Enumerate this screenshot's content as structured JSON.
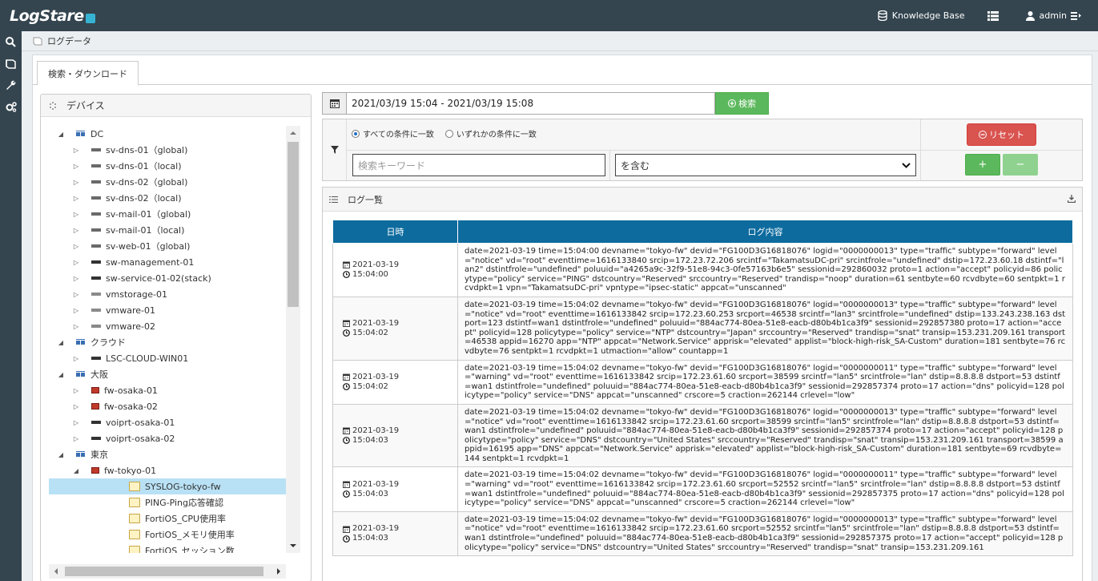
{
  "app": {
    "logo": "LogStare",
    "nav": {
      "knowledge_base": "Knowledge Base",
      "user": "admin"
    }
  },
  "breadcrumb": {
    "label": "ログデータ"
  },
  "tabs": [
    {
      "label": "検索・ダウンロード"
    }
  ],
  "device_panel": {
    "title": "デバイス",
    "tree": [
      {
        "label": "DC",
        "kind": "group",
        "toggle": "▲",
        "level": 0
      },
      {
        "label": "sv-dns-01（global)",
        "kind": "switch",
        "toggle": "▷",
        "level": 1
      },
      {
        "label": "sv-dns-01（local)",
        "kind": "switch",
        "toggle": "▷",
        "level": 1
      },
      {
        "label": "sv-dns-02（global)",
        "kind": "switch",
        "toggle": "▷",
        "level": 1
      },
      {
        "label": "sv-dns-02（local)",
        "kind": "switch",
        "toggle": "▷",
        "level": 1
      },
      {
        "label": "sv-mail-01（global)",
        "kind": "switch",
        "toggle": "▷",
        "level": 1
      },
      {
        "label": "sv-mail-01（local)",
        "kind": "switch",
        "toggle": "▷",
        "level": 1
      },
      {
        "label": "sv-web-01（global)",
        "kind": "switch",
        "toggle": "▷",
        "level": 1
      },
      {
        "label": "sw-management-01",
        "kind": "server",
        "toggle": "▷",
        "level": 1
      },
      {
        "label": "sw-service-01-02(stack)",
        "kind": "server",
        "toggle": "▷",
        "level": 1
      },
      {
        "label": "vmstorage-01",
        "kind": "vm",
        "toggle": "▷",
        "level": 1
      },
      {
        "label": "vmware-01",
        "kind": "vm",
        "toggle": "▷",
        "level": 1
      },
      {
        "label": "vmware-02",
        "kind": "vm",
        "toggle": "▷",
        "level": 1
      },
      {
        "label": "クラウド",
        "kind": "group",
        "toggle": "▲",
        "level": 0
      },
      {
        "label": "LSC-CLOUD-WIN01",
        "kind": "server",
        "toggle": "▷",
        "level": 1
      },
      {
        "label": "大阪",
        "kind": "group",
        "toggle": "▲",
        "level": 0
      },
      {
        "label": "fw-osaka-01",
        "kind": "fw",
        "toggle": "▷",
        "level": 1
      },
      {
        "label": "fw-osaka-02",
        "kind": "fw",
        "toggle": "▷",
        "level": 1
      },
      {
        "label": "voiprt-osaka-01",
        "kind": "server",
        "toggle": "▷",
        "level": 1
      },
      {
        "label": "voiprt-osaka-02",
        "kind": "server",
        "toggle": "▷",
        "level": 1
      },
      {
        "label": "東京",
        "kind": "group",
        "toggle": "▲",
        "level": 0
      },
      {
        "label": "fw-tokyo-01",
        "kind": "fw",
        "toggle": "▲",
        "level": 1
      },
      {
        "label": "SYSLOG-tokyo-fw",
        "kind": "folder",
        "toggle": "",
        "level": 2,
        "selected": true
      },
      {
        "label": "PING-Ping応答確認",
        "kind": "folder",
        "toggle": "",
        "level": 2
      },
      {
        "label": "FortiOS_CPU使用率",
        "kind": "folder",
        "toggle": "",
        "level": 2
      },
      {
        "label": "FortiOS_メモリ使用率",
        "kind": "folder",
        "toggle": "",
        "level": 2
      },
      {
        "label": "FortiOS_セッション数",
        "kind": "folder",
        "toggle": "",
        "level": 2
      }
    ]
  },
  "search": {
    "date_range": "2021/03/19 15:04 - 2021/03/19 15:08",
    "search_label": "検索",
    "match_all_label": "すべての条件に一致",
    "match_any_label": "いずれかの条件に一致",
    "keyword_placeholder": "検索キーワード",
    "operator_value": "を含む",
    "reset_label": "リセット",
    "add_label": "+",
    "remove_label": "−"
  },
  "log_list": {
    "title": "ログ一覧",
    "columns": [
      "日時",
      "ログ内容"
    ],
    "rows": [
      {
        "date": "2021-03-19",
        "time": "15:04:00",
        "content": "date=2021-03-19 time=15:04:00 devname=\"tokyo-fw\" devid=\"FG100D3G16818076\" logid=\"0000000013\" type=\"traffic\" subtype=\"forward\" level=\"notice\" vd=\"root\" eventtime=1616133840 srcip=172.23.72.206 srcintf=\"TakamatsuDC-pri\" srcintfrole=\"undefined\" dstip=172.23.60.18 dstintf=\"lan2\" dstintfrole=\"undefined\" poluuid=\"a4265a9c-32f9-51e8-94c3-0fe57163b6e5\" sessionid=292860032 proto=1 action=\"accept\" policyid=86 policytype=\"policy\" service=\"PING\" dstcountry=\"Reserved\" srccountry=\"Reserved\" trandisp=\"noop\" duration=61 sentbyte=60 rcvdbyte=60 sentpkt=1 rcvdpkt=1 vpn=\"TakamatsuDC-pri\" vpntype=\"ipsec-static\" appcat=\"unscanned\""
      },
      {
        "date": "2021-03-19",
        "time": "15:04:02",
        "content": "date=2021-03-19 time=15:04:02 devname=\"tokyo-fw\" devid=\"FG100D3G16818076\" logid=\"0000000013\" type=\"traffic\" subtype=\"forward\" level=\"notice\" vd=\"root\" eventtime=1616133842 srcip=172.23.60.253 srcport=46538 srcintf=\"lan3\" srcintfrole=\"undefined\" dstip=133.243.238.163 dstport=123 dstintf=wan1 dstintfrole=\"undefined\" poluuid=\"884ac774-80ea-51e8-eacb-d80b4b1ca3f9\" sessionid=292857380 proto=17 action=\"accept\" policyid=128 policytype=\"policy\" service=\"NTP\" dstcountry=\"Japan\" srccountry=\"Reserved\" trandisp=\"snat\" transip=153.231.209.161 transport=46538 appid=16270 app=\"NTP\" appcat=\"Network.Service\" apprisk=\"elevated\" applist=\"block-high-risk_SA-Custom\" duration=181 sentbyte=76 rcvdbyte=76 sentpkt=1 rcvdpkt=1 utmaction=\"allow\" countapp=1"
      },
      {
        "date": "2021-03-19",
        "time": "15:04:02",
        "content": "date=2021-03-19 time=15:04:02 devname=\"tokyo-fw\" devid=\"FG100D3G16818076\" logid=\"0000000011\" type=\"traffic\" subtype=\"forward\" level=\"warning\" vd=\"root\" eventtime=1616133842 srcip=172.23.61.60 srcport=38599 srcintf=\"lan5\" srcintfrole=\"lan\" dstip=8.8.8.8 dstport=53 dstintf=wan1 dstintfrole=\"undefined\" poluuid=\"884ac774-80ea-51e8-eacb-d80b4b1ca3f9\" sessionid=292857374 proto=17 action=\"dns\" policyid=128 policytype=\"policy\" service=\"DNS\" appcat=\"unscanned\" crscore=5 craction=262144 crlevel=\"low\""
      },
      {
        "date": "2021-03-19",
        "time": "15:04:03",
        "content": "date=2021-03-19 time=15:04:02 devname=\"tokyo-fw\" devid=\"FG100D3G16818076\" logid=\"0000000013\" type=\"traffic\" subtype=\"forward\" level=\"notice\" vd=\"root\" eventtime=1616133842 srcip=172.23.61.60 srcport=38599 srcintf=\"lan5\" srcintfrole=\"lan\" dstip=8.8.8.8 dstport=53 dstintf=wan1 dstintfrole=\"undefined\" poluuid=\"884ac774-80ea-51e8-eacb-d80b4b1ca3f9\" sessionid=292857374 proto=17 action=\"accept\" policyid=128 policytype=\"policy\" service=\"DNS\" dstcountry=\"United States\" srccountry=\"Reserved\" trandisp=\"snat\" transip=153.231.209.161 transport=38599 appid=16195 app=\"DNS\" appcat=\"Network.Service\" apprisk=\"elevated\" applist=\"block-high-risk_SA-Custom\" duration=181 sentbyte=69 rcvdbyte=144 sentpkt=1 rcvdpkt=1"
      },
      {
        "date": "2021-03-19",
        "time": "15:04:03",
        "content": "date=2021-03-19 time=15:04:02 devname=\"tokyo-fw\" devid=\"FG100D3G16818076\" logid=\"0000000011\" type=\"traffic\" subtype=\"forward\" level=\"warning\" vd=\"root\" eventtime=1616133842 srcip=172.23.61.60 srcport=52552 srcintf=\"lan5\" srcintfrole=\"lan\" dstip=8.8.8.8 dstport=53 dstintf=wan1 dstintfrole=\"undefined\" poluuid=\"884ac774-80ea-51e8-eacb-d80b4b1ca3f9\" sessionid=292857375 proto=17 action=\"dns\" policyid=128 policytype=\"policy\" service=\"DNS\" appcat=\"unscanned\" crscore=5 craction=262144 crlevel=\"low\""
      },
      {
        "date": "2021-03-19",
        "time": "15:04:03",
        "content": "date=2021-03-19 time=15:04:02 devname=\"tokyo-fw\" devid=\"FG100D3G16818076\" logid=\"0000000013\" type=\"traffic\" subtype=\"forward\" level=\"notice\" vd=\"root\" eventtime=1616133842 srcip=172.23.61.60 srcport=52552 srcintf=\"lan5\" srcintfrole=\"lan\" dstip=8.8.8.8 dstport=53 dstintf=wan1 dstintfrole=\"undefined\" poluuid=\"884ac774-80ea-51e8-eacb-d80b4b1ca3f9\" sessionid=292857375 proto=17 action=\"accept\" policyid=128 policytype=\"policy\" service=\"DNS\" dstcountry=\"United States\" srccountry=\"Reserved\" trandisp=\"snat\" transip=153.231.209.161"
      }
    ]
  },
  "colors": {
    "topbar": "#34454f",
    "table_header": "#0d6b9e",
    "success": "#5cb85c",
    "danger": "#d9534f",
    "selected_row": "#b9e1f5"
  }
}
